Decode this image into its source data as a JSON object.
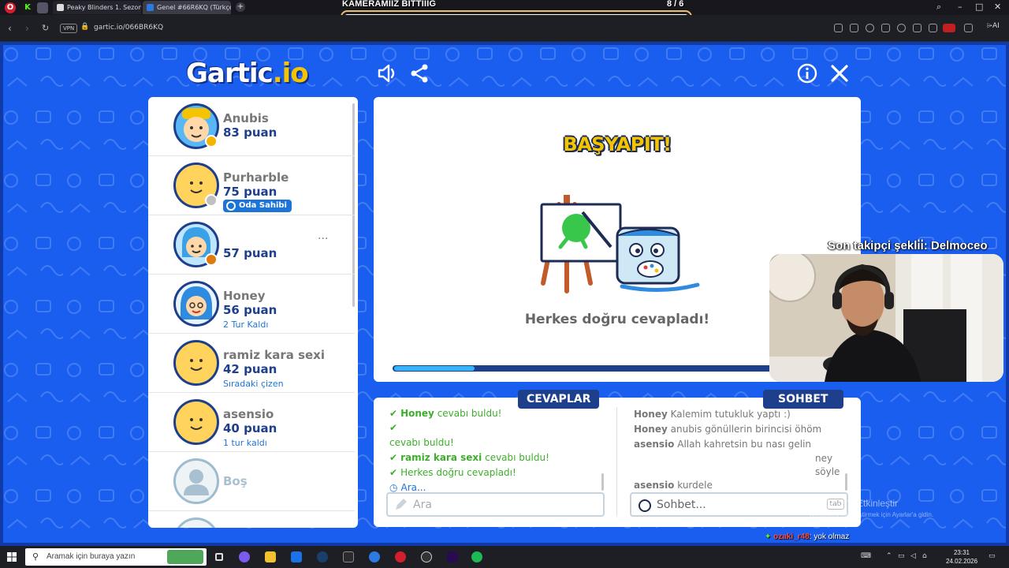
{
  "browser": {
    "tabs": [
      {
        "title": "Peaky Blinders 1. Sezon 1.",
        "active": false
      },
      {
        "title": "Genel #66R6KQ (Türkçe)",
        "active": true
      }
    ],
    "new_tab": "+",
    "address": "gartic.io/066BR6KQ",
    "vpn_label": "VPN",
    "ai_label": "AI",
    "window_controls": {
      "minimize": "–",
      "maximize": "□",
      "close": "✕"
    }
  },
  "stream_overlay": {
    "goal_title": "KAMERAMIIZ BİTTİİİG",
    "goal_count": "8 / 6",
    "goal_progress": 1.0,
    "follower_text": "Son takipçi şekli̇i̇: Delmoceo",
    "chat_user": "ozaki_r48",
    "chat_message": ": yok olmaz"
  },
  "game": {
    "logo_main": "Gartic",
    "logo_suffix": ".io",
    "players": [
      {
        "name": "Anubis",
        "score": "83 puan",
        "note": "",
        "badge_color": "#f5b400",
        "owner": false
      },
      {
        "name": "Purharble",
        "score": "75 puan",
        "note": "",
        "badge_color": "#c0c0c0",
        "owner": true,
        "owner_label": "Oda Sahibi"
      },
      {
        "name": "",
        "score": "57 puan",
        "note": "",
        "badge_color": "#e07a10",
        "owner": false,
        "menu": "···"
      },
      {
        "name": "Honey",
        "score": "56 puan",
        "note": "2 Tur Kaldı",
        "badge_color": "",
        "owner": false
      },
      {
        "name": "ramiz kara sexi",
        "score": "42 puan",
        "note": "Sıradaki çizen",
        "badge_color": "",
        "owner": false
      },
      {
        "name": "asensio",
        "score": "40 puan",
        "note": "1 tur kaldı",
        "badge_color": "",
        "owner": false
      },
      {
        "name": "Boş",
        "score": "",
        "note": "",
        "badge_color": "",
        "owner": false,
        "empty": true
      }
    ],
    "stage": {
      "headline": "BAŞYAPIT!",
      "message": "Herkes doğru cevapladı!",
      "progress": 0.18
    },
    "answers": {
      "tab_label": "CEVAPLAR",
      "lines": [
        {
          "who": "Honey",
          "text": "cevabı buldu!"
        },
        {
          "who": "",
          "text": ""
        },
        {
          "who": "",
          "text": "cevabı buldu!"
        },
        {
          "who": "ramiz kara sexi",
          "text": "cevabı buldu!"
        },
        {
          "who": "",
          "text": "Herkes doğru cevapladı!"
        },
        {
          "who": "",
          "text": "Ara..."
        }
      ],
      "input_placeholder": "Ara"
    },
    "chat": {
      "tab_label": "SOHBET",
      "lines": [
        {
          "who": "Honey",
          "text": "Kalemim tutukluk yaptı :)"
        },
        {
          "who": "Honey",
          "text": "anubis gönüllerin birincisi öhöm"
        },
        {
          "who": "asensio",
          "text": "Allah kahretsin bu nası gelin"
        },
        {
          "who": "",
          "text": "ney"
        },
        {
          "who": "",
          "text": "söyle"
        },
        {
          "who": "asensio",
          "text": "kurdele"
        }
      ],
      "input_placeholder": "Sohbet...",
      "tab_hint": "tab"
    }
  },
  "windows": {
    "activation_title": "Windows'u Etkinleştir",
    "activation_sub": "Windows'u etkinleştirmek için Ayarlar'a gidin."
  },
  "taskbar": {
    "search_placeholder": "Aramak için buraya yazın",
    "time": "23:31",
    "date": "24.02.2026"
  },
  "colors": {
    "game_bg": "#1a5ef0",
    "navy": "#1d3f8c",
    "accent_yellow": "#f5c400",
    "answer_green": "#3dae2b",
    "link_blue": "#1c74d9"
  }
}
